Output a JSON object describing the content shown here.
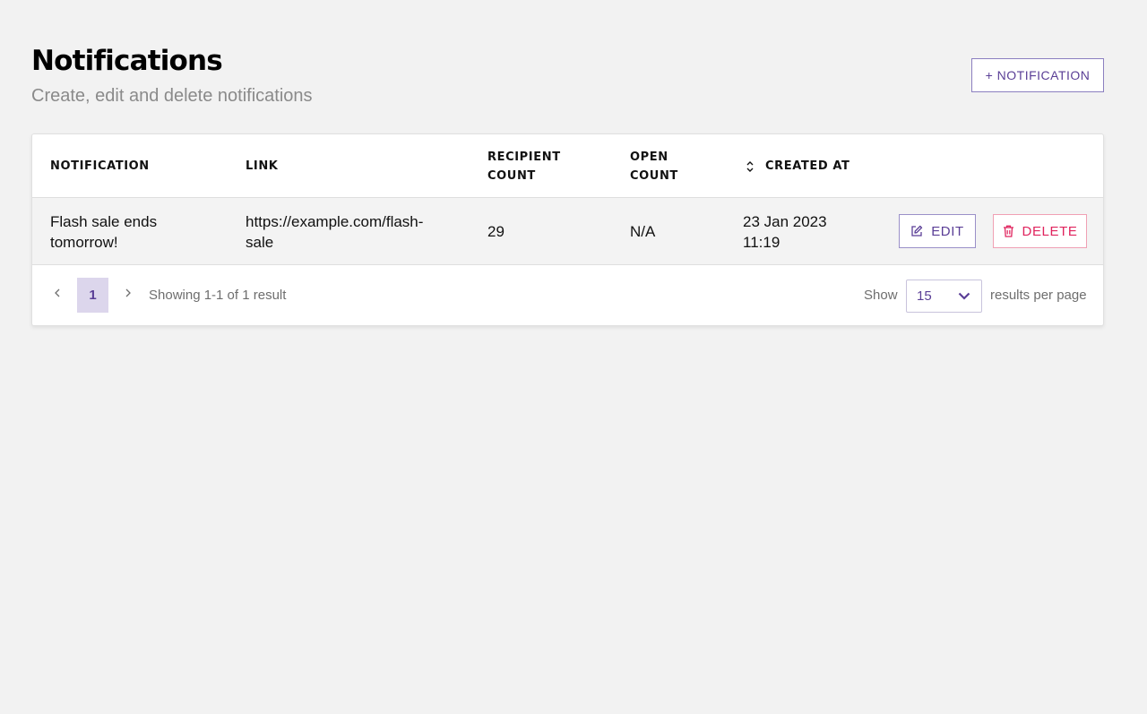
{
  "header": {
    "title": "Notifications",
    "subtitle": "Create, edit and delete notifications",
    "add_button_label": "+ NOTIFICATION"
  },
  "table": {
    "columns": [
      {
        "label": "NOTIFICATION"
      },
      {
        "label": "LINK"
      },
      {
        "label": "RECIPIENT COUNT"
      },
      {
        "label": "OPEN COUNT"
      },
      {
        "label": "CREATED AT",
        "sortable": true,
        "icon": "sort-icon"
      }
    ],
    "rows": [
      {
        "notification": "Flash sale ends tomorrow!",
        "link": "https://example.com/flash-sale",
        "recipient_count": "29",
        "open_count": "N/A",
        "created_at": "23 Jan 2023 11:19",
        "edit_label": "EDIT",
        "delete_label": "DELETE"
      }
    ]
  },
  "pagination": {
    "current_page": "1",
    "showing_text": "Showing 1-1 of 1 result",
    "show_label": "Show",
    "per_page_value": "15",
    "per_page_suffix": "results per page"
  },
  "icons": {
    "prev": "chevron-left-icon",
    "next": "chevron-right-icon",
    "select": "chevron-down-icon",
    "edit": "edit-icon",
    "delete": "trash-icon"
  },
  "colors": {
    "accent": "#5a3e96",
    "danger": "#e0245e",
    "background": "#f2f2f2",
    "page_active_bg": "#dcd6ec"
  }
}
